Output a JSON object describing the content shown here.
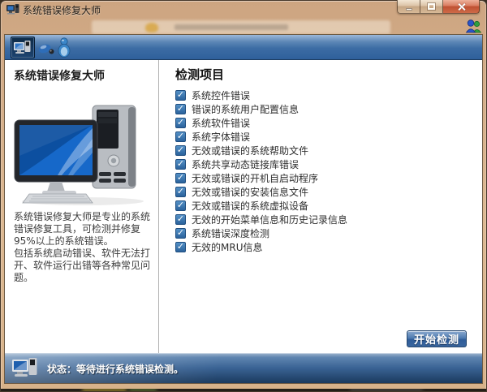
{
  "window": {
    "title": "系统错误修复大师",
    "controls": {
      "minimize_icon": "minimize-icon",
      "maximize_icon": "maximize-icon",
      "close_icon": "close-icon"
    }
  },
  "icons": {
    "app_icon": "computer-icon",
    "support_icon": "online-support-icon",
    "toolbar_selected_icon": "computer-repair-icon",
    "toolbar_mouse_icon": "mouse-icon",
    "toolbar_assistant_icon": "assistant-icon",
    "status_icon": "computer-icon",
    "check_glyph": "✓"
  },
  "colors": {
    "frame_tan": "#d9b892",
    "toolbar_blue": "#3c6ca4",
    "selected_navy": "#143providers",
    "checkbox_blue": "#2b639c",
    "status_navy": "#1b3a5e",
    "button_blue": "#3a669f",
    "close_red": "#bf5032"
  },
  "left_panel": {
    "heading": "系统错误修复大师",
    "description": [
      "系统错误修复大师是专业的系统错误修复工具，可检测并修复95%以上的系统错误。",
      "包括系统启动错误、软件无法打开、软件运行出错等各种常见问题。"
    ]
  },
  "right_panel": {
    "heading": "检测项目",
    "items": [
      "系统控件错误",
      "错误的系统用户配置信息",
      "系统软件错误",
      "系统字体错误",
      "无效或错误的系统帮助文件",
      "系统共享动态链接库错误",
      "无效或错误的开机自启动程序",
      "无效或错误的安装信息文件",
      "无效或错误的系统虚拟设备",
      "无效的开始菜单信息和历史记录信息",
      "系统错误深度检测",
      "无效的MRU信息"
    ],
    "start_button": "开始检测"
  },
  "status_bar": {
    "text": "状态：等待进行系统错误检测。"
  }
}
